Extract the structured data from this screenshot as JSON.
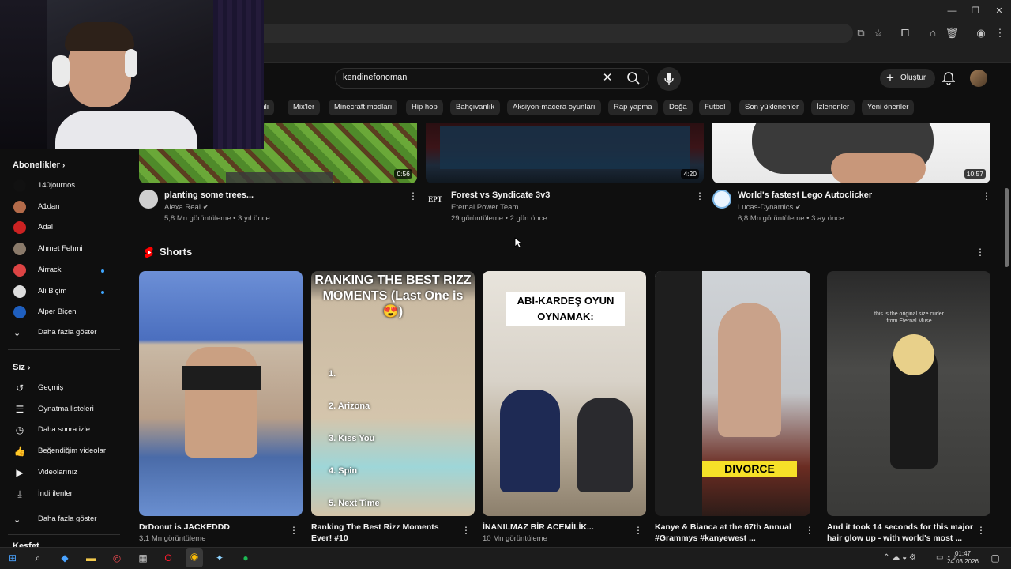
{
  "search": {
    "query": "kendinefonoman"
  },
  "header": {
    "create_label": "Oluştur"
  },
  "chips": [
    "anlı",
    "Mix'ler",
    "Minecraft modları",
    "Hip hop",
    "Bahçıvanlık",
    "Aksiyon-macera oyunları",
    "Rap yapma",
    "Doğa",
    "Futbol",
    "Son yüklenenler",
    "İzlenenler",
    "Yeni öneriler"
  ],
  "sidebar": {
    "subscriptions_heading": "Abonelikler",
    "subscriptions": [
      {
        "label": "140journos",
        "dot": false
      },
      {
        "label": "A1dan",
        "dot": false
      },
      {
        "label": "Adal",
        "dot": false
      },
      {
        "label": "Ahmet Fehmi",
        "dot": false
      },
      {
        "label": "Airrack",
        "dot": true
      },
      {
        "label": "Ali Biçim",
        "dot": true
      },
      {
        "label": "Alper Biçen",
        "dot": false
      }
    ],
    "show_more": "Daha fazla göster",
    "you_heading": "Siz",
    "you_items": [
      {
        "label": "Geçmiş",
        "icon": "history-icon"
      },
      {
        "label": "Oynatma listeleri",
        "icon": "playlist-icon"
      },
      {
        "label": "Daha sonra izle",
        "icon": "clock-icon"
      },
      {
        "label": "Beğendiğim videolar",
        "icon": "like-icon"
      },
      {
        "label": "Videolarınız",
        "icon": "video-icon"
      },
      {
        "label": "İndirilenler",
        "icon": "download-icon"
      }
    ],
    "you_show_more": "Daha fazla göster",
    "explore_heading": "Keşfet"
  },
  "videos": [
    {
      "title": "planting some trees...",
      "channel": "Alexa Real",
      "verified": true,
      "stats": "5,8 Mn görüntüleme • 3 yıl önce",
      "duration": "0:56",
      "avatar_text": ""
    },
    {
      "title": "Forest vs Syndicate 3v3",
      "channel": "Eternal Power Team",
      "verified": false,
      "stats": "29 görüntüleme • 2 gün önce",
      "duration": "4:20",
      "avatar_text": "EPT"
    },
    {
      "title": "World's fastest Lego Autoclicker",
      "channel": "Lucas-Dynamics",
      "verified": true,
      "stats": "6,8 Mn görüntüleme • 3 ay önce",
      "duration": "10:57",
      "avatar_text": ""
    }
  ],
  "shorts": {
    "heading": "Shorts",
    "items": [
      {
        "title": "DrDonut is JACKEDDD",
        "views": "3,1 Mn görüntüleme",
        "overlay": ""
      },
      {
        "title": "Ranking The Best Rizz Moments Ever! #10",
        "views": "",
        "overlay": "RANKING THE BEST RIZZ MOMENTS (Last One is 😍)"
      },
      {
        "title": "İNANILMAZ BİR ACEMİLİK...",
        "views": "10 Mn görüntüleme",
        "overlay": "ABİ-KARDEŞ OYUN OYNAMAK:"
      },
      {
        "title": "Kanye & Bianca at the 67th Annual #Grammys #kanyewest ...",
        "views": "",
        "overlay": "DIVORCE"
      },
      {
        "title": "And it took 14 seconds for this major hair glow up - with world's most ...",
        "views": "",
        "overlay": ""
      }
    ]
  },
  "thumb_text": {
    "rizz_list": [
      "1.",
      "2. Arizona",
      "3. Kiss You",
      "4. Spin",
      "5. Next Time"
    ],
    "hair_caption": "this is the original size curler from Eternal Muse"
  },
  "taskbar": {
    "time": "01:47",
    "date": "24.03.2026"
  },
  "colors": {
    "background": "#0f0f0f",
    "chip": "#272727",
    "accent": "#ff0000",
    "dot": "#3ea6ff"
  }
}
